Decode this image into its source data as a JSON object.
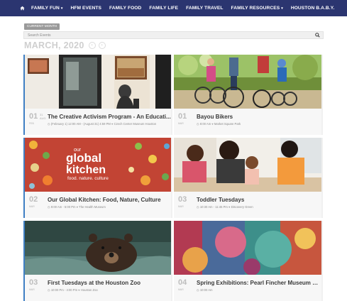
{
  "nav": {
    "items": [
      {
        "label": "FAMILY FUN",
        "caret": true
      },
      {
        "label": "HFM EVENTS",
        "caret": false
      },
      {
        "label": "FAMILY FOOD",
        "caret": false
      },
      {
        "label": "FAMILY LIFE",
        "caret": false
      },
      {
        "label": "FAMILY TRAVEL",
        "caret": false
      },
      {
        "label": "FAMILY RESOURCES",
        "caret": true
      },
      {
        "label": "HOUSTON B.A.B.Y.",
        "caret": false
      }
    ]
  },
  "calendar": {
    "current_month_label": "CURRENT MONTH",
    "search_placeholder": "Search Events",
    "month_title": "MARCH, 2020"
  },
  "events": [
    {
      "day": "01",
      "dow": "FEB",
      "day2": "31\nAUG",
      "title": "The Creative Activism Program - An Educati...",
      "time": "(February 1) 12:00 AM - (August 31) 4:59 PM",
      "venue": "Czech Center Museum Houston"
    },
    {
      "day": "01",
      "dow": "MAR",
      "day2": "",
      "title": "Bayou Bikers",
      "time": "8:00 Am",
      "venue": "Market Square Park"
    },
    {
      "day": "02",
      "dow": "MAR",
      "day2": "",
      "title": "Our Global Kitchen: Food, Nature, Culture",
      "time": "9:00 Am - 5:00 Pm",
      "venue": "The Health Museum"
    },
    {
      "day": "03",
      "dow": "MAR",
      "day2": "",
      "title": "Toddler Tuesdays",
      "time": "10:30 Am - 11:45 Pm",
      "venue": "Discovery Green"
    },
    {
      "day": "03",
      "dow": "MAR",
      "day2": "",
      "title": "First Tuesdays at the Houston Zoo",
      "time": "10:00 Pm - 4:00 Pm",
      "venue": "Houston Zoo"
    },
    {
      "day": "04",
      "dow": "MAR",
      "day2": "",
      "title": "Spring Exhibitions: Pearl Fincher Museum o...",
      "time": "10:00 Am",
      "venue": ""
    }
  ],
  "kitchen_sign": {
    "line1": "our",
    "line2": "global",
    "line3": "kitchen",
    "line4": "food. nature. culture"
  }
}
